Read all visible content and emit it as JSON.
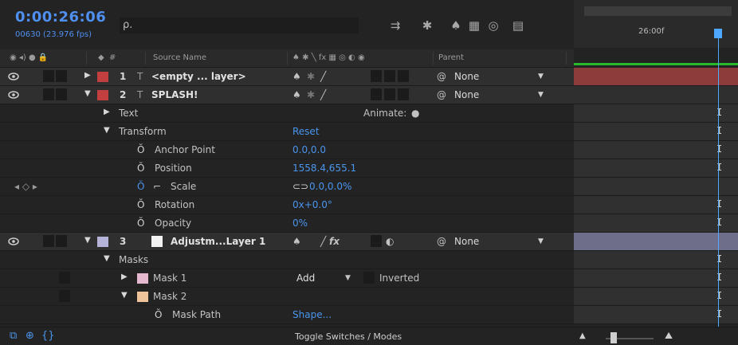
{
  "header": {
    "timecode": "0:00:26:06",
    "frames": "00630 (23.976 fps)",
    "search_icon": "ρ.",
    "time_ruler_label": "26:00f"
  },
  "columns": {
    "source_name": "Source Name",
    "number": "#",
    "parent": "Parent"
  },
  "layers": [
    {
      "number": "1",
      "name": "<empty ... layer>",
      "type_icon": "T",
      "label_color": "#c23f3f",
      "parent": "None",
      "expanded": false
    },
    {
      "number": "2",
      "name": "SPLASH!",
      "type_icon": "T",
      "label_color": "#c23f3f",
      "parent": "None",
      "expanded": true
    },
    {
      "number": "3",
      "name": "Adjustm...Layer 1",
      "label_color": "#b5b3d8",
      "parent": "None",
      "expanded": true
    }
  ],
  "properties": {
    "text": "Text",
    "animate_label": "Animate:",
    "transform": "Transform",
    "reset": "Reset",
    "anchor_point": {
      "label": "Anchor Point",
      "value": "0.0,0.0"
    },
    "position": {
      "label": "Position",
      "value": "1558.4,655.1"
    },
    "scale": {
      "label": "Scale",
      "value": "0.0,0.0%"
    },
    "rotation": {
      "label": "Rotation",
      "value": "0x+0.0°"
    },
    "opacity": {
      "label": "Opacity",
      "value": "0%"
    },
    "masks": "Masks",
    "mask1": {
      "label": "Mask 1",
      "mode": "Add",
      "inverted": "Inverted",
      "color": "#e6b8cf"
    },
    "mask2": {
      "label": "Mask 2",
      "color": "#f0c49a"
    },
    "mask_path": {
      "label": "Mask Path",
      "value": "Shape..."
    }
  },
  "footer": {
    "toggle_label": "Toggle Switches / Modes"
  },
  "colors": {
    "accent": "#4a95ee",
    "playhead": "#4fa8ff",
    "layer_red_bar": "#8e3b3b",
    "layer_lavender_bar": "#6f6e8a",
    "work_area_green": "#27b727"
  }
}
